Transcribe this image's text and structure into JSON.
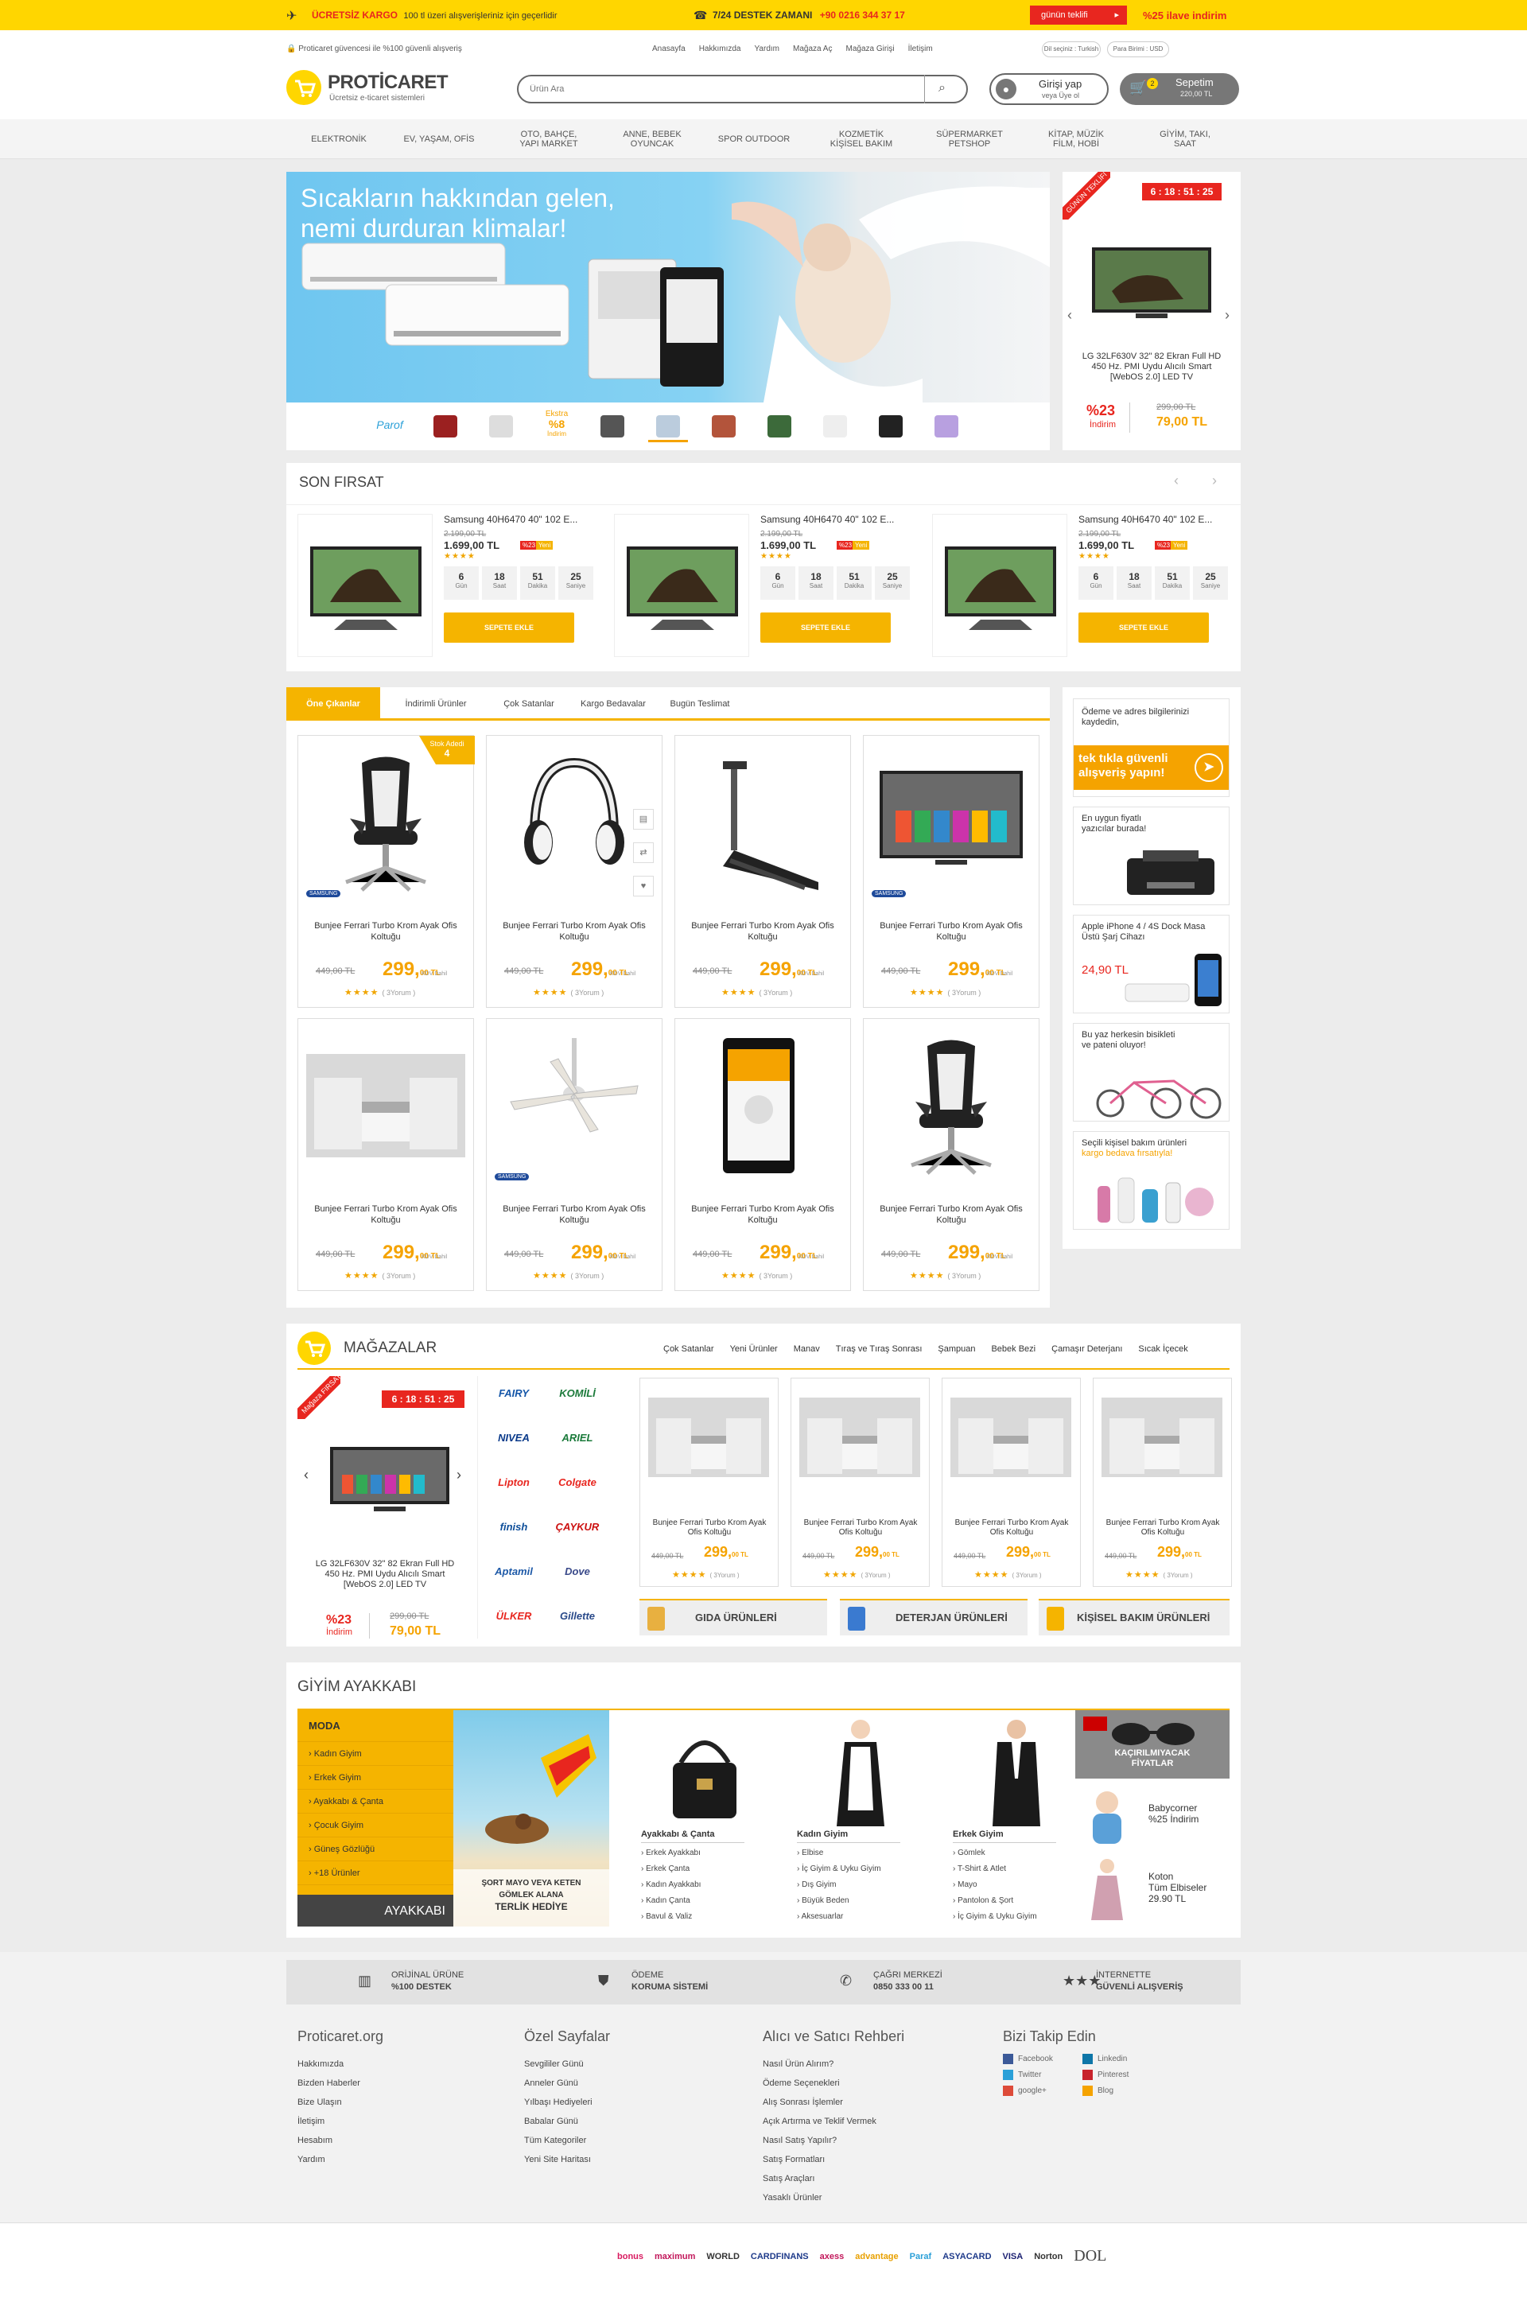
{
  "topbar": {
    "cargo_bold": "ÜCRETSİZ KARGO",
    "cargo_text": "100 tl üzeri alışverişleriniz için geçerlidir",
    "support_bold": "7/24 DESTEK ZAMANI",
    "support_phone": "+90 0216 344 37 17",
    "deal_label": "günün teklifi",
    "discount": "%25 ilave indirim"
  },
  "header": {
    "trust_text": "Proticaret güvencesi ile %100 güvenli alışveriş",
    "links": [
      "Anasayfa",
      "Hakkımızda",
      "Yardım",
      "Mağaza Aç",
      "Mağaza Girişi",
      "İletişim"
    ],
    "language": "Dil seçiniz : Turkish",
    "currency": "Para Birimi : USD",
    "logo_name": "PROTİCARET",
    "logo_tagline": "Ücretsiz e-ticaret sistemleri",
    "search_placeholder": "Ürün Ara",
    "login_label": "Girişi yap",
    "login_sub": "veya Üye ol",
    "cart_label": "Sepetim",
    "cart_amount": "220,00 TL",
    "cart_count": "2"
  },
  "nav": [
    {
      "line1": "ELEKTRONİK",
      "line2": ""
    },
    {
      "line1": "EV, YAŞAM, OFİS",
      "line2": ""
    },
    {
      "line1": "OTO, BAHÇE,",
      "line2": "YAPI MARKET"
    },
    {
      "line1": "ANNE, BEBEK",
      "line2": "OYUNCAK"
    },
    {
      "line1": "SPOR OUTDOOR",
      "line2": ""
    },
    {
      "line1": "KOZMETİK",
      "line2": "KİŞİSEL BAKIM"
    },
    {
      "line1": "SÜPERMARKET",
      "line2": "PETSHOP"
    },
    {
      "line1": "KİTAP, MÜZİK",
      "line2": "FİLM, HOBİ"
    },
    {
      "line1": "GİYİM, TAKI,",
      "line2": "SAAT"
    }
  ],
  "hero": {
    "headline1": "Sıcakların hakkından gelen,",
    "headline2": "nemi durduran klimalar!",
    "brand": "Parof",
    "extra_label": "Ekstra",
    "extra_value": "%8",
    "extra_sub": "İndirim"
  },
  "daily_deal": {
    "ribbon": "GÜNÜN TEKLİFİ",
    "timer": "6 : 18 : 51 : 25",
    "name": "LG 32LF630V 32\" 82 Ekran Full HD 450 Hz. PMI Uydu Alıcılı Smart [WebOS 2.0] LED TV",
    "discount": "%23",
    "discount_label": "İndirim",
    "old_price": "299,00 TL",
    "new_price": "79,00 TL"
  },
  "last_chance": {
    "title": "SON FIRSAT",
    "items": [
      {
        "name": "Samsung 40H6470 40\" 102 E...",
        "old": "2.199,00 TL",
        "price": "1.699,00 TL",
        "badge": "%23",
        "badge2": "Yeni",
        "d": "6",
        "h": "18",
        "m": "51",
        "s": "25",
        "btn": "SEPETE EKLE"
      },
      {
        "name": "Samsung 40H6470 40\" 102 E...",
        "old": "2.199,00 TL",
        "price": "1.699,00 TL",
        "badge": "%23",
        "badge2": "Yeni",
        "d": "6",
        "h": "18",
        "m": "51",
        "s": "25",
        "btn": "SEPETE EKLE"
      },
      {
        "name": "Samsung 40H6470 40\" 102 E...",
        "old": "2.199,00 TL",
        "price": "1.699,00 TL",
        "badge": "%23",
        "badge2": "Yeni",
        "d": "6",
        "h": "18",
        "m": "51",
        "s": "25",
        "btn": "SEPETE EKLE"
      }
    ],
    "units": [
      "Gün",
      "Saat",
      "Dakika",
      "Saniye"
    ]
  },
  "tabs": [
    "Öne Çıkanlar",
    "İndirimli Ürünler",
    "Çok Satanlar",
    "Kargo Bedavalar",
    "Bugün Teslimat"
  ],
  "stock": {
    "label": "Stok Adedi",
    "value": "4"
  },
  "products": [
    {
      "name": "Bunjee Ferrari Turbo Krom Ayak Ofis Koltuğu",
      "old": "449,00 TL",
      "price": "299,",
      "cents": "00 TL",
      "kdv": "KDV Dahil",
      "reviews": "( 3Yorum )",
      "img": "chair"
    },
    {
      "name": "Bunjee Ferrari Turbo Krom Ayak Ofis Koltuğu",
      "old": "449,00 TL",
      "price": "299,",
      "cents": "00 TL",
      "kdv": "KDV Dahil",
      "reviews": "( 3Yorum )",
      "img": "headphones"
    },
    {
      "name": "Bunjee Ferrari Turbo Krom Ayak Ofis Koltuğu",
      "old": "449,00 TL",
      "price": "299,",
      "cents": "00 TL",
      "kdv": "KDV Dahil",
      "reviews": "( 3Yorum )",
      "img": "treadmill"
    },
    {
      "name": "Bunjee Ferrari Turbo Krom Ayak Ofis Koltuğu",
      "old": "449,00 TL",
      "price": "299,",
      "cents": "00 TL",
      "kdv": "KDV Dahil",
      "reviews": "( 3Yorum )",
      "img": "tv"
    },
    {
      "name": "Bunjee Ferrari Turbo Krom Ayak Ofis Koltuğu",
      "old": "449,00 TL",
      "price": "299,",
      "cents": "00 TL",
      "kdv": "KDV Dahil",
      "reviews": "( 3Yorum )",
      "img": "room"
    },
    {
      "name": "Bunjee Ferrari Turbo Krom Ayak Ofis Koltuğu",
      "old": "449,00 TL",
      "price": "299,",
      "cents": "00 TL",
      "kdv": "KDV Dahil",
      "reviews": "( 3Yorum )",
      "img": "fan"
    },
    {
      "name": "Bunjee Ferrari Turbo Krom Ayak Ofis Koltuğu",
      "old": "449,00 TL",
      "price": "299,",
      "cents": "00 TL",
      "kdv": "KDV Dahil",
      "reviews": "( 3Yorum )",
      "img": "phone"
    },
    {
      "name": "Bunjee Ferrari Turbo Krom Ayak Ofis Koltuğu",
      "old": "449,00 TL",
      "price": "299,",
      "cents": "00 TL",
      "kdv": "KDV Dahil",
      "reviews": "( 3Yorum )",
      "img": "chair"
    }
  ],
  "brand_logo": "SAMSUNG",
  "side_ads": {
    "a1_text": "Ödeme ve adres bilgilerinizi kaydedin,",
    "a1_banner1": "tek tıkla güvenli",
    "a1_banner2": "alışveriş yapın!",
    "a2_text": "En uygun fiyatlı yazıcılar burada!",
    "a3_text": "Apple iPhone 4 / 4S Dock Masa Üstü Şarj Cihazı",
    "a3_price": "24,90 TL",
    "a4_text": "Bu yaz herkesin bisikleti ve pateni oluyor!",
    "a5_text1": "Seçili kişisel bakım ürünleri",
    "a5_text2": "kargo bedava fırsatıyla!"
  },
  "stores": {
    "title": "MAĞAZALAR",
    "links": [
      "Çok Satanlar",
      "Yeni Ürünler",
      "Manav",
      "Tıraş ve Tıraş Sonrası",
      "Şampuan",
      "Bebek Bezi",
      "Çamaşır Deterjanı",
      "Sıcak İçecek"
    ],
    "ribbon": "Mağaza FIRSAT",
    "brands": [
      "FAIRY",
      "KOMİLİ",
      "NIVEA",
      "ARIEL",
      "Lipton",
      "Colgate",
      "finish",
      "ÇAYKUR",
      "Aptamil",
      "Dove",
      "ÜLKER",
      "Gillette"
    ],
    "card_name": "Bunjee Ferrari Turbo Krom Ayak Ofis Koltuğu",
    "categories": [
      "GIDA ÜRÜNLERİ",
      "DETERJAN ÜRÜNLERİ",
      "KİŞİSEL BAKIM ÜRÜNLERİ"
    ]
  },
  "fashion": {
    "title": "GİYİM AYAKKABI",
    "menu_title": "MODA",
    "menu": [
      "Kadın Giyim",
      "Erkek Giyim",
      "Ayakkabı & Çanta",
      "Çocuk Giyim",
      "Güneş Gözlüğü",
      "+18 Ürünler"
    ],
    "menu_footer": "AYAKKABI",
    "promo1": "ŞORT MAYO VEYA KETEN",
    "promo2": "GÖMLEK ALANA",
    "promo3": "TERLİK HEDİYE",
    "cols": [
      {
        "title": "Ayakkabı & Çanta",
        "items": [
          "Erkek Ayakkabı",
          "Erkek Çanta",
          "Kadın Ayakkabı",
          "Kadın Çanta",
          "Bavul & Valiz"
        ]
      },
      {
        "title": "Kadın Giyim",
        "items": [
          "Elbise",
          "İç Giyim & Uyku Giyim",
          "Dış Giyim",
          "Büyük Beden",
          "Aksesuarlar"
        ]
      },
      {
        "title": "Erkek Giyim",
        "items": [
          "Gömlek",
          "T-Shirt & Atlet",
          "Mayo",
          "Pantolon & Şort",
          "İç Giyim & Uyku Giyim"
        ]
      }
    ],
    "ad1a": "KAÇIRILMIYACAK",
    "ad1b": "FİYATLAR",
    "ad2a": "Babycorner",
    "ad2b": "%25 İndirim",
    "ad3a": "Koton",
    "ad3b": "Tüm Elbiseler",
    "ad3c": "29.90 TL"
  },
  "features": [
    {
      "l1": "ORİJİNAL ÜRÜNE",
      "l2": "%100 DESTEK"
    },
    {
      "l1": "ÖDEME",
      "l2": "KORUMA SİSTEMİ"
    },
    {
      "l1": "ÇAĞRI MERKEZİ",
      "l2": "0850 333 00 11"
    },
    {
      "l1": "İNTERNETTE",
      "l2": "GÜVENLİ ALIŞVERİŞ"
    }
  ],
  "footer": {
    "c1": {
      "title": "Proticaret.org",
      "items": [
        "Hakkımızda",
        "Bizden Haberler",
        "Bize Ulaşın",
        "İletişim",
        "Hesabım",
        "Yardım"
      ]
    },
    "c2": {
      "title": "Özel Sayfalar",
      "items": [
        "Sevgililer Günü",
        "Anneler Günü",
        "Yılbaşı Hediyeleri",
        "Babalar Günü",
        "Tüm Kategoriler",
        "Yeni Site Haritası"
      ]
    },
    "c3": {
      "title": "Alıcı ve Satıcı Rehberi",
      "items": [
        "Nasıl Ürün Alırım?",
        "Ödeme Seçenekleri",
        "Alış Sonrası İşlemler",
        "Açık Artırma ve Teklif Vermek",
        "Nasıl Satış Yapılır?",
        "Satış Formatları",
        "Satış Araçları",
        "Yasaklı Ürünler"
      ]
    },
    "c4": {
      "title": "Bizi Takip Edin",
      "social": [
        "Facebook",
        "Linkedin",
        "Twitter",
        "Pinterest",
        "google+",
        "Blog"
      ]
    }
  },
  "payments": [
    "bonus",
    "maximum",
    "WORLD",
    "CARDFINANS",
    "axess",
    "advantage",
    "Paraf",
    "ASYACARD",
    "VISA",
    "Norton",
    "DOL"
  ],
  "colors": {
    "accent": "#ffd600",
    "orange": "#f5b400",
    "red": "#e8261f"
  }
}
